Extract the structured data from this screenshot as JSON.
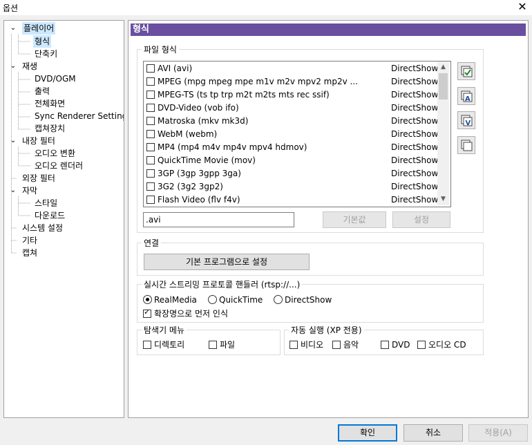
{
  "window": {
    "title": "옵션"
  },
  "tree": {
    "items": [
      {
        "label": "플레이어",
        "toggle": "⌄"
      },
      {
        "label": "형식",
        "toggle": ""
      },
      {
        "label": "단축키",
        "toggle": ""
      },
      {
        "label": "재생",
        "toggle": "⌄"
      },
      {
        "label": "DVD/OGM",
        "toggle": ""
      },
      {
        "label": "출력",
        "toggle": ""
      },
      {
        "label": "전체화면",
        "toggle": ""
      },
      {
        "label": "Sync Renderer Settings",
        "toggle": ""
      },
      {
        "label": "캡쳐장치",
        "toggle": ""
      },
      {
        "label": "내장 필터",
        "toggle": "⌄"
      },
      {
        "label": "오디오 변환",
        "toggle": ""
      },
      {
        "label": "오디오 렌더러",
        "toggle": ""
      },
      {
        "label": "외장 필터",
        "toggle": ""
      },
      {
        "label": "자막",
        "toggle": "⌄"
      },
      {
        "label": "스타일",
        "toggle": ""
      },
      {
        "label": "다운로드",
        "toggle": ""
      },
      {
        "label": "시스템 설정",
        "toggle": ""
      },
      {
        "label": "기타",
        "toggle": ""
      },
      {
        "label": "캡쳐",
        "toggle": ""
      }
    ]
  },
  "panel": {
    "header": "형식",
    "file_formats": {
      "legend": "파일 형식",
      "rows": [
        {
          "name": "AVI (avi)",
          "type": "DirectShow"
        },
        {
          "name": "MPEG (mpg mpeg mpe m1v m2v mpv2 mp2v ...",
          "type": "DirectShow"
        },
        {
          "name": "MPEG-TS (ts tp trp m2t m2ts mts rec ssif)",
          "type": "DirectShow"
        },
        {
          "name": "DVD-Video (vob ifo)",
          "type": "DirectShow"
        },
        {
          "name": "Matroska (mkv mk3d)",
          "type": "DirectShow"
        },
        {
          "name": "WebM (webm)",
          "type": "DirectShow"
        },
        {
          "name": "MP4 (mp4 m4v mp4v mpv4 hdmov)",
          "type": "DirectShow"
        },
        {
          "name": "QuickTime Movie (mov)",
          "type": "DirectShow"
        },
        {
          "name": "3GP (3gp 3gpp 3ga)",
          "type": "DirectShow"
        },
        {
          "name": "3G2 (3g2 3gp2)",
          "type": "DirectShow"
        },
        {
          "name": "Flash Video (flv f4v)",
          "type": "DirectShow"
        }
      ],
      "ext_value": ".avi",
      "default_label": "기본값",
      "set_label": "설정"
    },
    "association": {
      "legend": "연결",
      "button": "기본 프로그램으로 설정"
    },
    "streaming": {
      "legend": "실시간 스트리밍 프로토콜 핸들러 (rtsp://...)",
      "options": [
        "RealMedia",
        "QuickTime",
        "DirectShow"
      ],
      "selected": "RealMedia",
      "check_label": "확장명으로 먼저 인식"
    },
    "explorer": {
      "legend": "탐색기 메뉴",
      "items": [
        "디렉토리",
        "파일"
      ]
    },
    "autoplay": {
      "legend": "자동 실행 (XP 전용)",
      "items": [
        "비디오",
        "음악",
        "DVD",
        "오디오 CD"
      ]
    }
  },
  "footer": {
    "ok": "확인",
    "cancel": "취소",
    "apply": "적용(A)"
  },
  "colors": {
    "header": "#6a4ea0",
    "selection": "#cce8ff",
    "ok_border": "#0078d7"
  }
}
